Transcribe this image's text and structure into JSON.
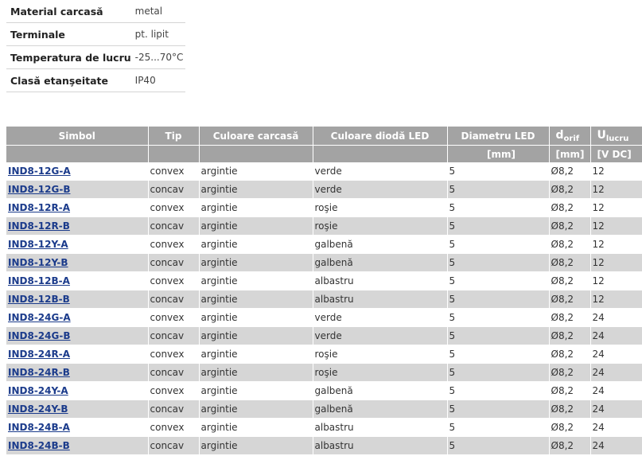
{
  "specs": [
    {
      "label": "Material carcasă",
      "value": "metal"
    },
    {
      "label": "Terminale",
      "value": "pt. lipit"
    },
    {
      "label": "Temperatura de lucru",
      "value": "-25...70°C"
    },
    {
      "label": "Clasă etanşeitate",
      "value": "IP40"
    }
  ],
  "table": {
    "headers": {
      "simbol": "Simbol",
      "tip": "Tip",
      "culoare_carcasa": "Culoare carcasă",
      "culoare_dioda": "Culoare diodă LED",
      "diametru": "Diametru LED",
      "d_main": "d",
      "d_sub": "orif",
      "u_main": "U",
      "u_sub": "lucru"
    },
    "units": {
      "diametru": "[mm]",
      "d": "[mm]",
      "u": "[V DC]"
    },
    "rows": [
      {
        "simbol": "IND8-12G-A",
        "tip": "convex",
        "carcasa": "argintie",
        "dioda": "verde",
        "diametru": "5",
        "d": "Ø8,2",
        "u": "12"
      },
      {
        "simbol": "IND8-12G-B",
        "tip": "concav",
        "carcasa": "argintie",
        "dioda": "verde",
        "diametru": "5",
        "d": "Ø8,2",
        "u": "12"
      },
      {
        "simbol": "IND8-12R-A",
        "tip": "convex",
        "carcasa": "argintie",
        "dioda": "roşie",
        "diametru": "5",
        "d": "Ø8,2",
        "u": "12"
      },
      {
        "simbol": "IND8-12R-B",
        "tip": "concav",
        "carcasa": "argintie",
        "dioda": "roşie",
        "diametru": "5",
        "d": "Ø8,2",
        "u": "12"
      },
      {
        "simbol": "IND8-12Y-A",
        "tip": "convex",
        "carcasa": "argintie",
        "dioda": "galbenă",
        "diametru": "5",
        "d": "Ø8,2",
        "u": "12"
      },
      {
        "simbol": "IND8-12Y-B",
        "tip": "concav",
        "carcasa": "argintie",
        "dioda": "galbenă",
        "diametru": "5",
        "d": "Ø8,2",
        "u": "12"
      },
      {
        "simbol": "IND8-12B-A",
        "tip": "convex",
        "carcasa": "argintie",
        "dioda": "albastru",
        "diametru": "5",
        "d": "Ø8,2",
        "u": "12"
      },
      {
        "simbol": "IND8-12B-B",
        "tip": "concav",
        "carcasa": "argintie",
        "dioda": "albastru",
        "diametru": "5",
        "d": "Ø8,2",
        "u": "12"
      },
      {
        "simbol": "IND8-24G-A",
        "tip": "convex",
        "carcasa": "argintie",
        "dioda": "verde",
        "diametru": "5",
        "d": "Ø8,2",
        "u": "24"
      },
      {
        "simbol": "IND8-24G-B",
        "tip": "concav",
        "carcasa": "argintie",
        "dioda": "verde",
        "diametru": "5",
        "d": "Ø8,2",
        "u": "24"
      },
      {
        "simbol": "IND8-24R-A",
        "tip": "convex",
        "carcasa": "argintie",
        "dioda": "roşie",
        "diametru": "5",
        "d": "Ø8,2",
        "u": "24"
      },
      {
        "simbol": "IND8-24R-B",
        "tip": "concav",
        "carcasa": "argintie",
        "dioda": "roşie",
        "diametru": "5",
        "d": "Ø8,2",
        "u": "24"
      },
      {
        "simbol": "IND8-24Y-A",
        "tip": "convex",
        "carcasa": "argintie",
        "dioda": "galbenă",
        "diametru": "5",
        "d": "Ø8,2",
        "u": "24"
      },
      {
        "simbol": "IND8-24Y-B",
        "tip": "concav",
        "carcasa": "argintie",
        "dioda": "galbenă",
        "diametru": "5",
        "d": "Ø8,2",
        "u": "24"
      },
      {
        "simbol": "IND8-24B-A",
        "tip": "convex",
        "carcasa": "argintie",
        "dioda": "albastru",
        "diametru": "5",
        "d": "Ø8,2",
        "u": "24"
      },
      {
        "simbol": "IND8-24B-B",
        "tip": "concav",
        "carcasa": "argintie",
        "dioda": "albastru",
        "diametru": "5",
        "d": "Ø8,2",
        "u": "24"
      }
    ]
  },
  "colors": {
    "header_bg": "#a3a3a3",
    "row_alt_bg": "#d6d6d6",
    "link": "#1b3b8b"
  }
}
